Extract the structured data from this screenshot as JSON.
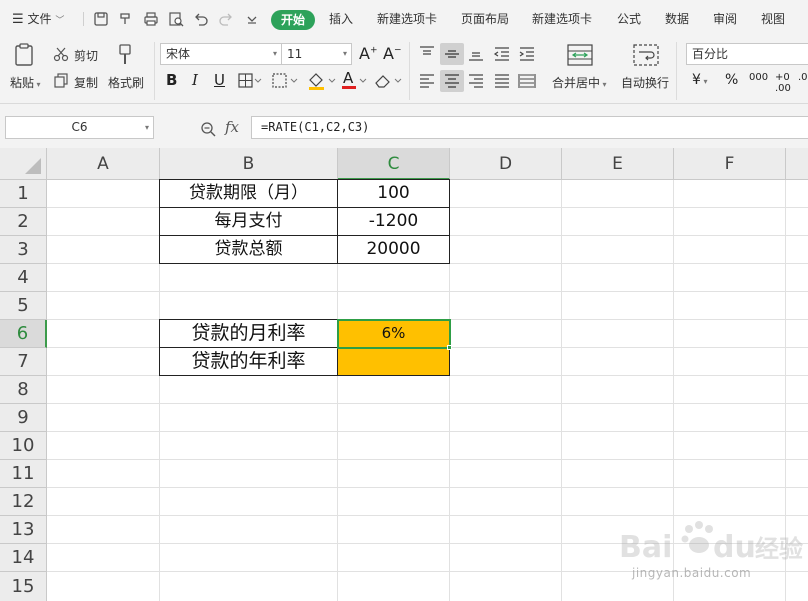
{
  "menu": {
    "file": "文件",
    "tabs": [
      "开始",
      "插入",
      "新建选项卡",
      "页面布局",
      "新建选项卡",
      "公式",
      "数据",
      "审阅",
      "视图"
    ]
  },
  "ribbon": {
    "paste": "粘贴",
    "cut": "剪切",
    "copy": "复制",
    "format_painter": "格式刷",
    "font_name": "宋体",
    "font_size": "11",
    "merge_center": "合并居中",
    "wrap_text": "自动换行",
    "number_format": "百分比",
    "currency_symbol": "¥",
    "percent_symbol": "%",
    "thousands_symbol": "000"
  },
  "formula_bar": {
    "name_box": "C6",
    "fx": "fx",
    "formula": "=RATE(C1,C2,C3)"
  },
  "sheet": {
    "columns": [
      "A",
      "B",
      "C",
      "D",
      "E",
      "F"
    ],
    "rows": [
      "1",
      "2",
      "3",
      "4",
      "5",
      "6",
      "7",
      "8",
      "9",
      "10",
      "11",
      "12",
      "13",
      "14",
      "15"
    ],
    "active_cell": "C6",
    "cells": {
      "B1": "贷款期限（月）",
      "C1": "100",
      "B2": "每月支付",
      "C2": "-1200",
      "B3": "贷款总额",
      "C3": "20000",
      "B6": "贷款的月利率",
      "C6": "6%",
      "B7": "贷款的年利率",
      "C7": ""
    }
  },
  "watermark": {
    "text": "jingyan.baidu.com"
  },
  "colors": {
    "accent": "#2da25a",
    "highlight_fill": "#ffc000",
    "selection": "#2e9e46"
  }
}
